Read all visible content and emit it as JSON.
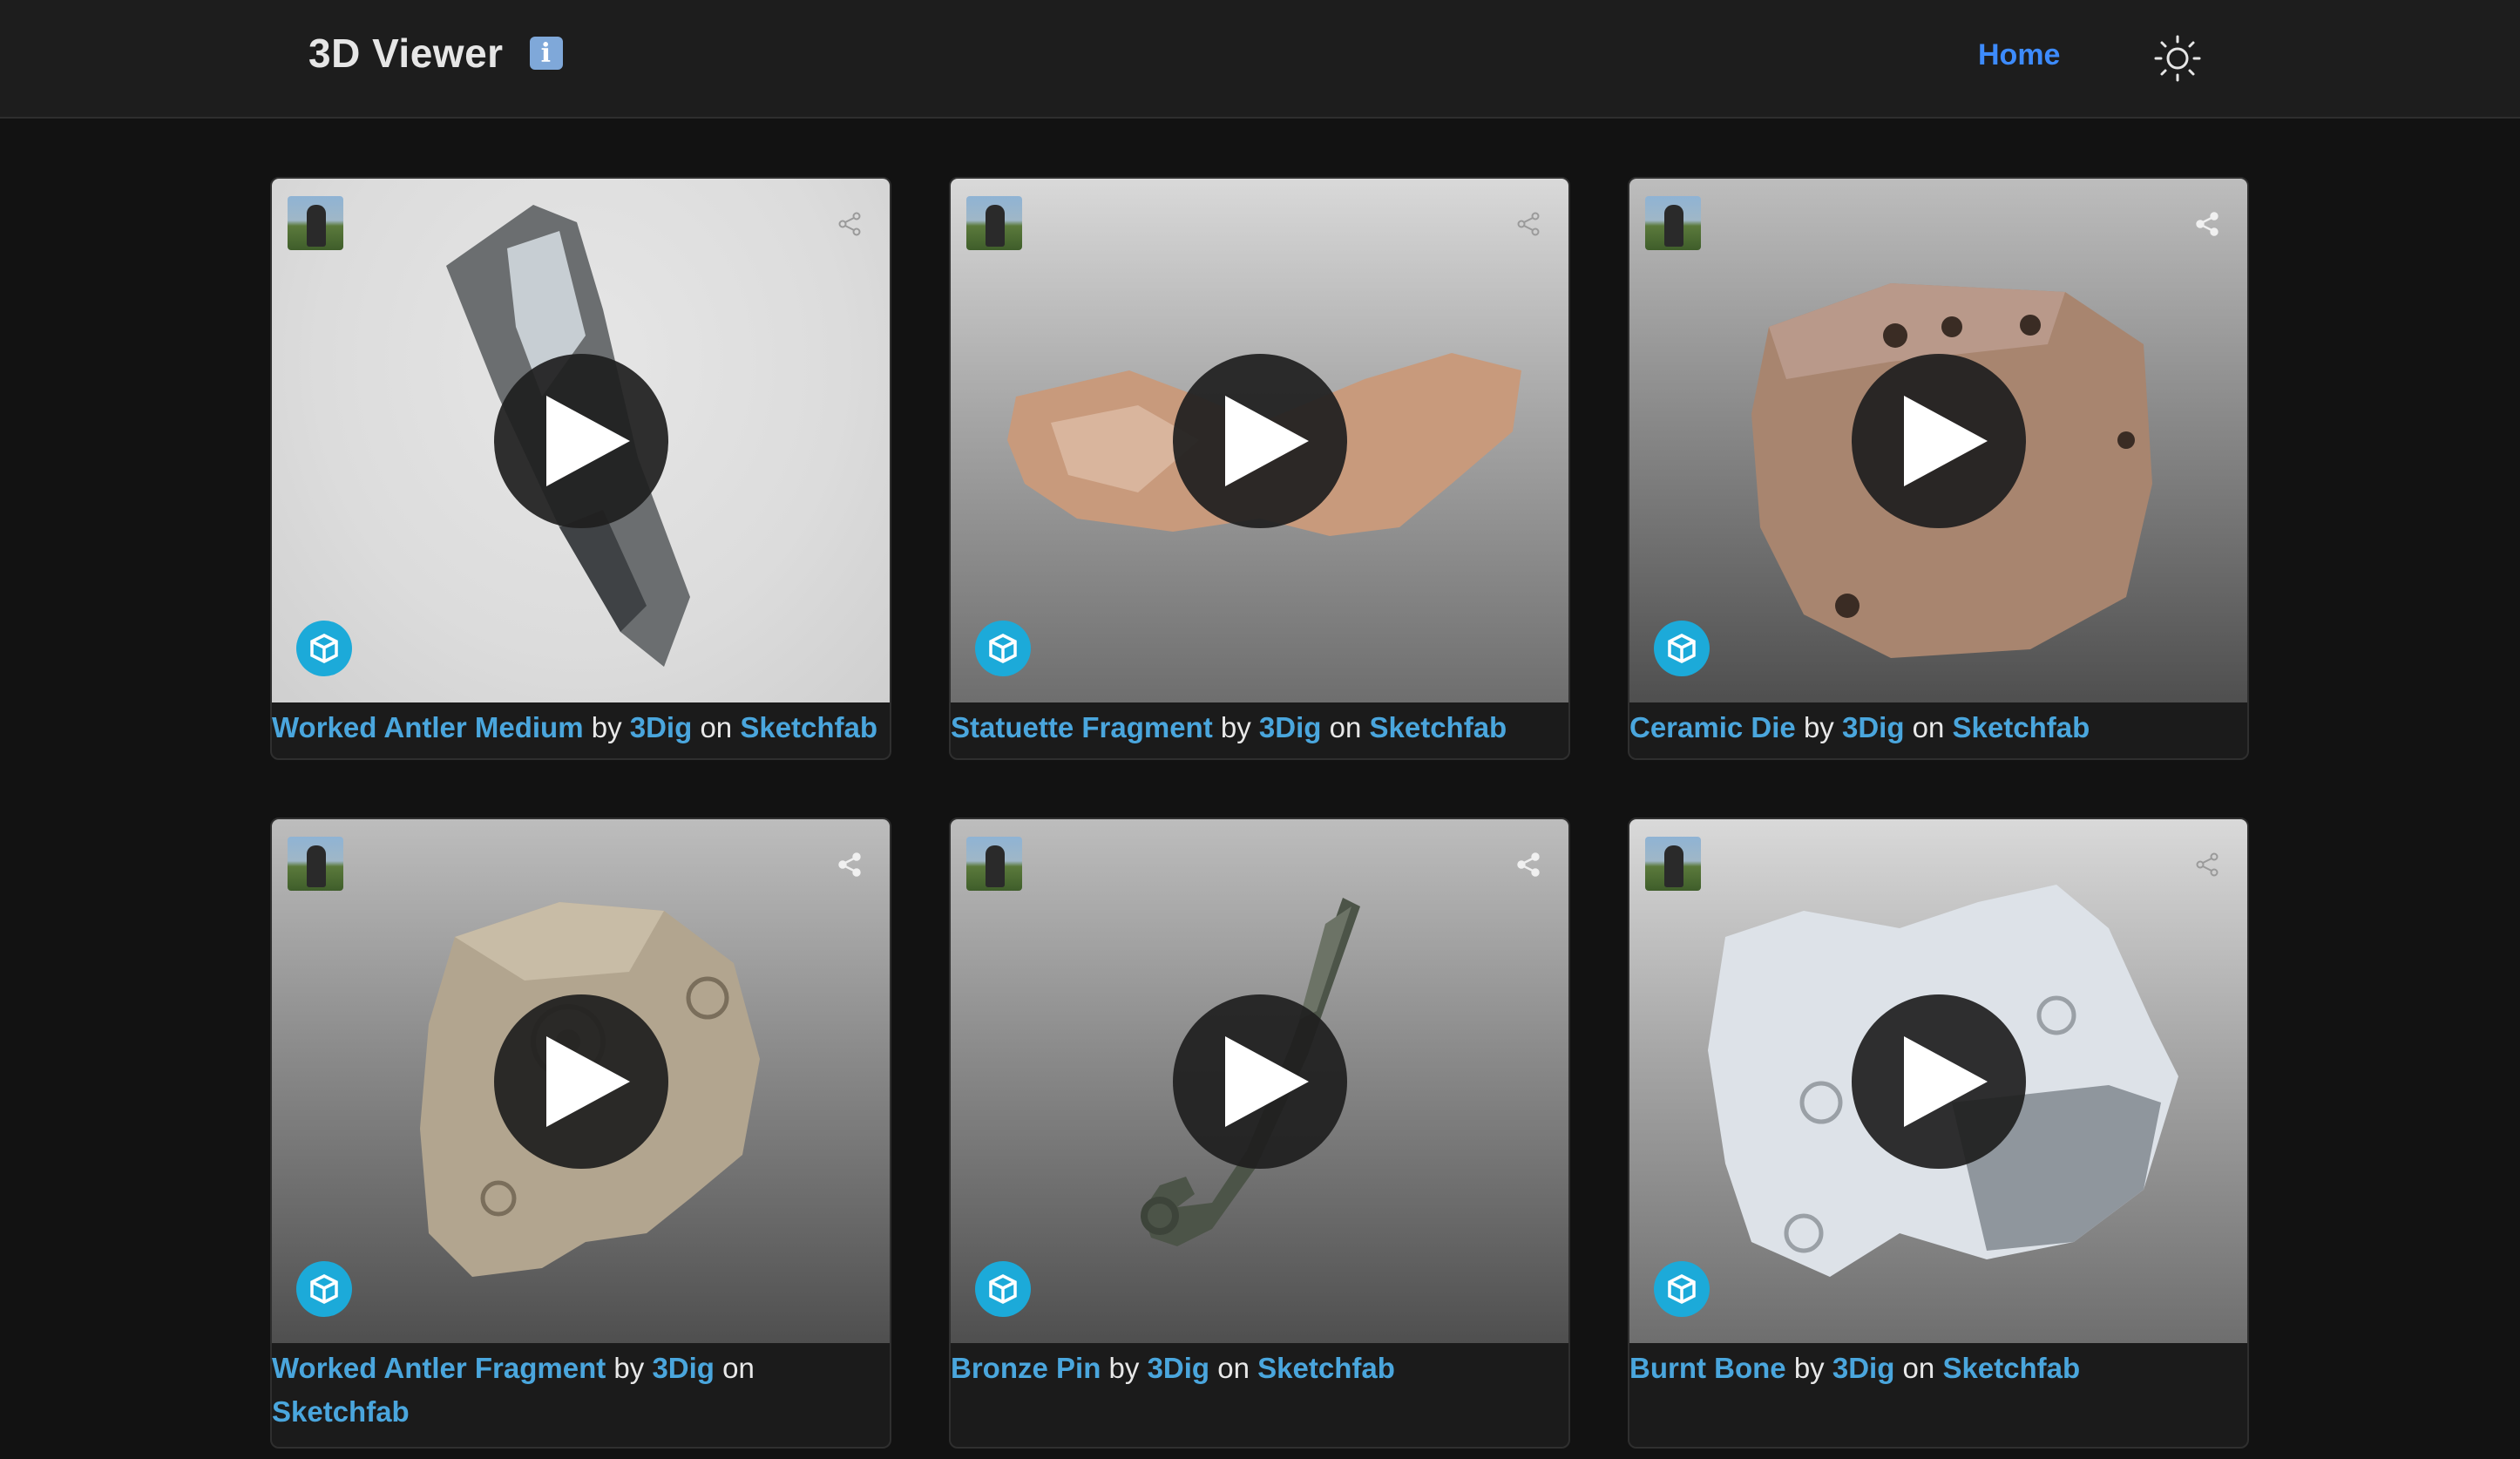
{
  "navbar": {
    "title": "3D Viewer",
    "info_icon": "info-icon",
    "info_glyph": "i",
    "home_label": "Home",
    "theme_icon": "sun-icon"
  },
  "caption_words": {
    "by": "by",
    "on": "on"
  },
  "models": [
    {
      "title": "Worked Antler Medium",
      "author": "3Dig",
      "platform": "Sketchfab"
    },
    {
      "title": "Statuette Fragment",
      "author": "3Dig",
      "platform": "Sketchfab"
    },
    {
      "title": "Ceramic Die",
      "author": "3Dig",
      "platform": "Sketchfab"
    },
    {
      "title": "Worked Antler Fragment",
      "author": "3Dig",
      "platform": "Sketchfab"
    },
    {
      "title": "Bronze Pin",
      "author": "3Dig",
      "platform": "Sketchfab"
    },
    {
      "title": "Burnt Bone",
      "author": "3Dig",
      "platform": "Sketchfab"
    }
  ],
  "colors": {
    "navbar_bg": "#1d1d1d",
    "page_bg": "#121212",
    "link": "#4aa6dd",
    "nav_active": "#3d8bfd",
    "sketchfab_blue": "#1caad9"
  }
}
